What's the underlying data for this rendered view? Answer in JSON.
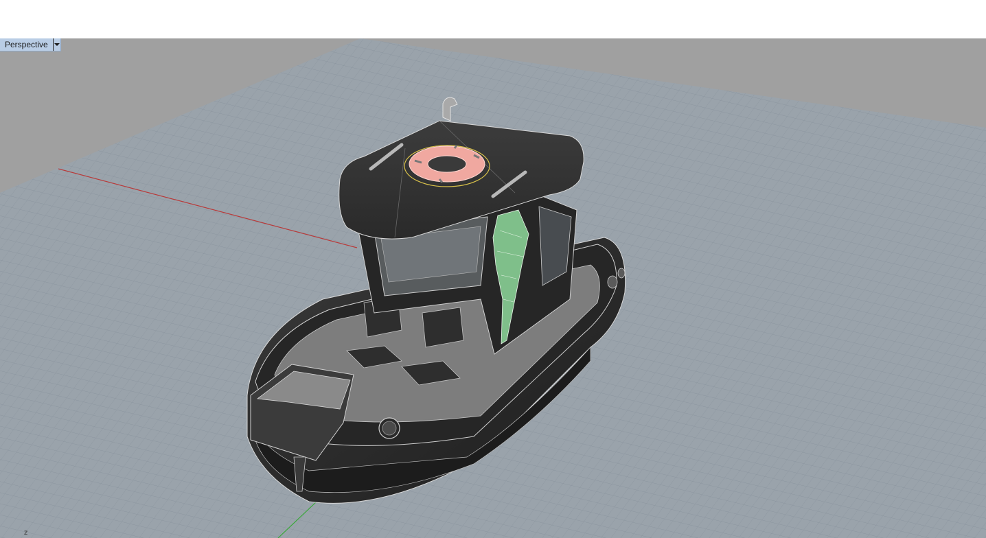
{
  "viewport": {
    "name": "Perspective",
    "menu_icon": "chevron-down-icon",
    "colors": {
      "background": "#a0a0a0",
      "grid": "#8a949e",
      "x_axis": "#b83a3a",
      "z_axis": "#3aa83a",
      "tab": "#b9cde5"
    }
  },
  "axis_widget": {
    "label": "z"
  },
  "scene": {
    "model": "tugboat",
    "hull_color": "#2a2a2a",
    "life_ring_color": "#f0a8a0",
    "figure_color": "#7fbf8a"
  }
}
